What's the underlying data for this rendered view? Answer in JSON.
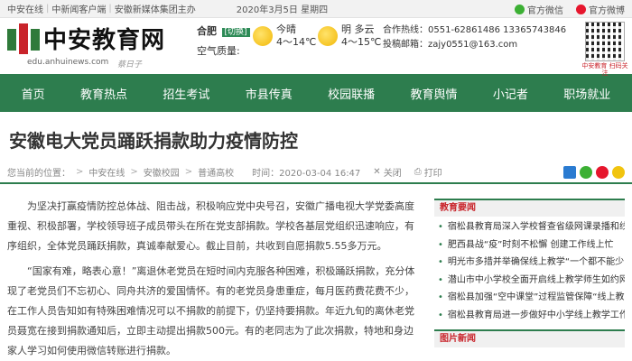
{
  "topbar": {
    "links": [
      "中安在线",
      "中新闻客户端",
      "安徽新媒体集团主办"
    ],
    "date": "2020年3月5日 星期四",
    "official_wechat": "官方微信",
    "official_weibo": "官方微博"
  },
  "header": {
    "logo_text": "中安教育网",
    "logo_url": "edu.anhuinews.com",
    "logo_signature": "蔡日子",
    "weather": {
      "city": "合肥",
      "switch_label": "[切换]",
      "air_label": "空气质量:",
      "today_label": "今晴",
      "today_temp": "4～14℃",
      "tomorrow_label": "明 多云",
      "tomorrow_temp": "4～15℃"
    },
    "contact": {
      "phone": "合作热线：0551-62861486 13365743846",
      "email": "投稿邮箱：zajy0551@163.com"
    },
    "qr_caption": "中安教育 扫码关注"
  },
  "nav": {
    "items": [
      "首页",
      "教育热点",
      "招生考试",
      "市县传真",
      "校园联播",
      "教育舆情",
      "小记者",
      "职场就业"
    ]
  },
  "article": {
    "title": "安徽电大党员踊跃捐款助力疫情防控",
    "breadcrumb": {
      "prefix": "您当前的位置：",
      "path": [
        "中安在线",
        "安徽校园",
        "普通高校"
      ],
      "time": "时间：2020-03-04 16:47",
      "close": "关闭",
      "print": "打印"
    },
    "paragraphs": [
      "为坚决打赢疫情防控总体战、阻击战，积极响应党中央号召，安徽广播电视大学党委高度重视、积极部署，学校领导班子成员带头在所在党支部捐款。学校各基层党组织迅速响应，有序组织，全体党员踊跃捐款，真诚奉献爱心。截止目前，共收到自愿捐款5.55多万元。",
      "“国家有难，略表心意！”离退休老党员在短时间内克服各种困难，积极踊跃捐款，充分体现了老党员们不忘初心、同舟共济的爱国情怀。有的老党员身患重症，每月医药费花费不少，在工作人员告知如有特殊困难情况可以不捐款的前提下，仍坚持要捐款。年近九旬的离休老党员聂宽在接到捐款通知后，立即主动提出捐款500元。有的老同志为了此次捐款，特地和身边家人学习如何使用微信转账进行捐款。"
    ]
  },
  "sidebar": {
    "education_news_title": "教育要闻",
    "education_news": [
      "宿松县教育局深入学校督查省级网课录播和线上",
      "肥西县战“疫”时刻不松懈 创建工作线上忙",
      "明光市多措并举确保线上教学“一个都不能少”",
      "潜山市中小学校全面开启线上教学师生如约网",
      "宿松县加强“空中课堂”过程监管保障“线上教",
      "宿松县教育局进一步做好中小学线上教学工作"
    ],
    "photo_news_title": "图片新闻"
  }
}
